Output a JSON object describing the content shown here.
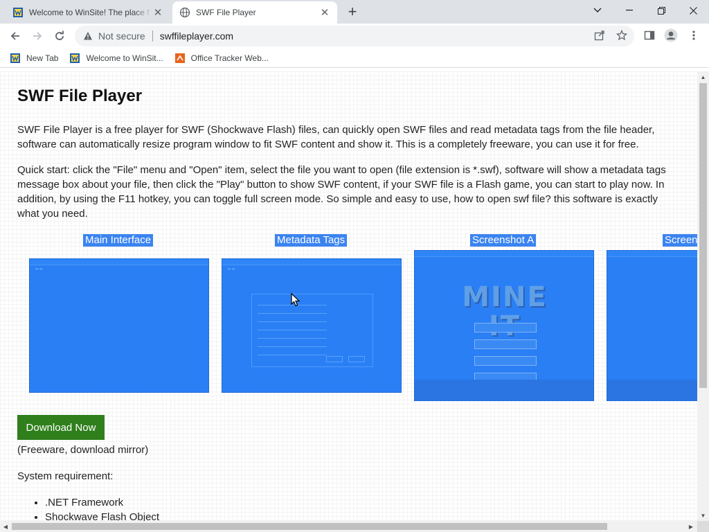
{
  "browser": {
    "tabs": [
      {
        "title": "Welcome to WinSite! The place f",
        "active": false
      },
      {
        "title": "SWF File Player",
        "active": true
      }
    ],
    "security_label": "Not secure",
    "url": "swffileplayer.com",
    "bookmarks": [
      {
        "label": "New Tab",
        "icon": "winsite-favicon"
      },
      {
        "label": "Welcome to WinSit...",
        "icon": "winsite-favicon"
      },
      {
        "label": "Office Tracker Web...",
        "icon": "office-tracker-favicon"
      }
    ]
  },
  "page": {
    "title": "SWF File Player",
    "intro": "SWF File Player is a free player for SWF (Shockwave Flash) files, can quickly open SWF files and read metadata tags from the file header, software can automatically resize program window to fit SWF content and show it. This is a completely freeware, you can use it for free.",
    "quick_start": "Quick start: click the \"File\" menu and \"Open\" item, select the file you want to open (file extension is *.swf), software will show a metadata tags message box about your file, then click the \"Play\" button to show SWF content, if your SWF file is a Flash game, you can start to play now. In addition, by using the F11 hotkey, you can toggle full screen mode. So simple and easy to use, how to open swf file? this software is exactly what you need.",
    "screenshots": [
      {
        "caption": "Main Interface"
      },
      {
        "caption": "Metadata Tags"
      },
      {
        "caption": "Screenshot A"
      },
      {
        "caption": "Screen"
      }
    ],
    "download_label": "Download Now",
    "freeware_note": "(Freeware, download mirror)",
    "system_requirement_label": "System requirement:",
    "requirements": [
      ".NET Framework",
      "Shockwave Flash Object"
    ]
  },
  "colors": {
    "selection_blue": "#3b84f0",
    "download_green": "#2f7f1c"
  }
}
